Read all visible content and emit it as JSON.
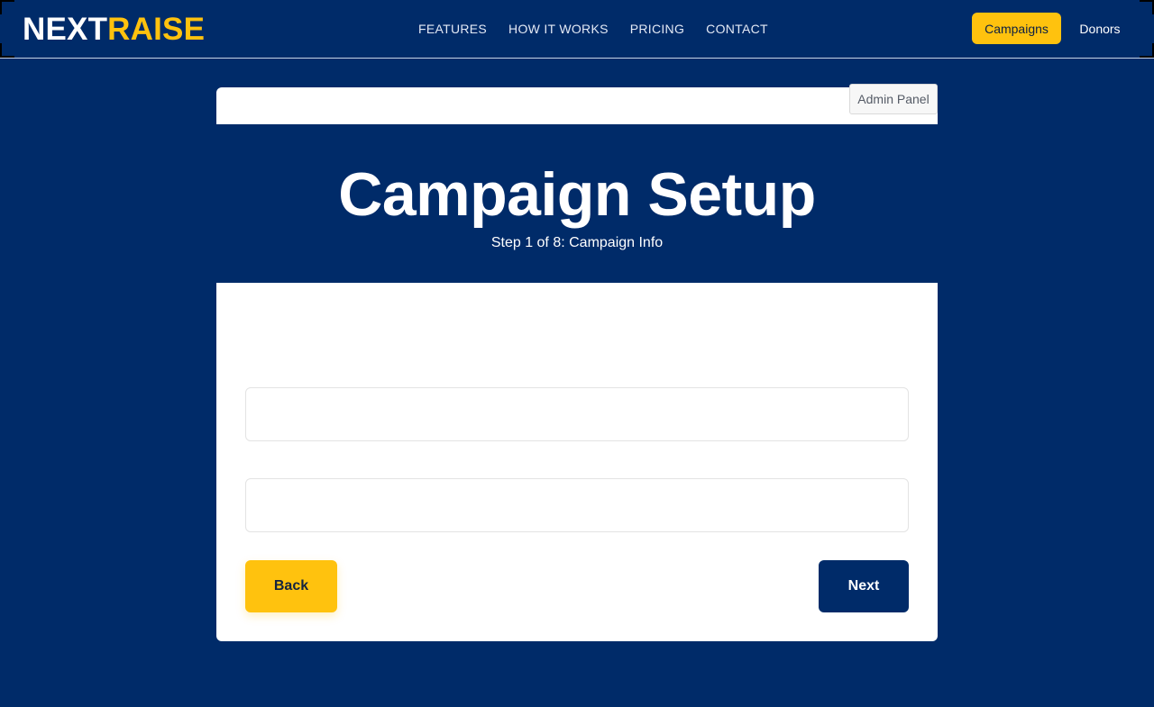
{
  "brand": {
    "part1": "NEXT",
    "part2": "RAISE"
  },
  "nav": {
    "features": "FEATURES",
    "how_it_works": "HOW IT WORKS",
    "pricing": "PRICING",
    "contact": "CONTACT"
  },
  "header_actions": {
    "campaigns": "Campaigns",
    "donors": "Donors"
  },
  "admin": {
    "label": "Admin Panel"
  },
  "page": {
    "title": "Campaign Setup",
    "subtitle": "Step 1 of 8: Campaign Info"
  },
  "form": {
    "field1": {
      "value": "",
      "placeholder": ""
    },
    "field2": {
      "value": "",
      "placeholder": ""
    },
    "back_label": "Back",
    "next_label": "Next"
  },
  "colors": {
    "background": "#002b69",
    "accent": "#ffc20e",
    "card": "#ffffff"
  }
}
